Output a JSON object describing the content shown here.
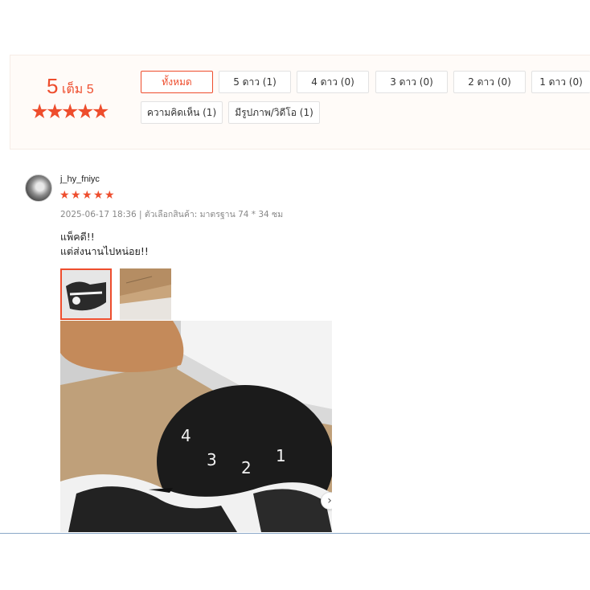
{
  "rating": {
    "score": "5",
    "out_of": "เต็ม 5",
    "stars": 5
  },
  "filters": {
    "all": "ทั้งหมด",
    "star5": "5 ดาว (1)",
    "star4": "4 ดาว (0)",
    "star3": "3 ดาว (0)",
    "star2": "2 ดาว (0)",
    "star1": "1 ดาว (0)",
    "comments": "ความคิดเห็น (1)",
    "media": "มีรูปภาพ/วิดีโอ (1)"
  },
  "review": {
    "username": "j_hy_fniyc",
    "stars": 5,
    "meta": "2025-06-17 18:36 | ตัวเลือกสินค้า: มาตรฐาน 74 * 34 ซม",
    "comment_line1": "แพ็คดี!!",
    "comment_line2": "แต่ส่งนานไปหน่อย!!"
  },
  "colors": {
    "accent": "#ee4d2d"
  },
  "icons": {
    "star": "star-icon",
    "next": "chevron-right-icon"
  }
}
